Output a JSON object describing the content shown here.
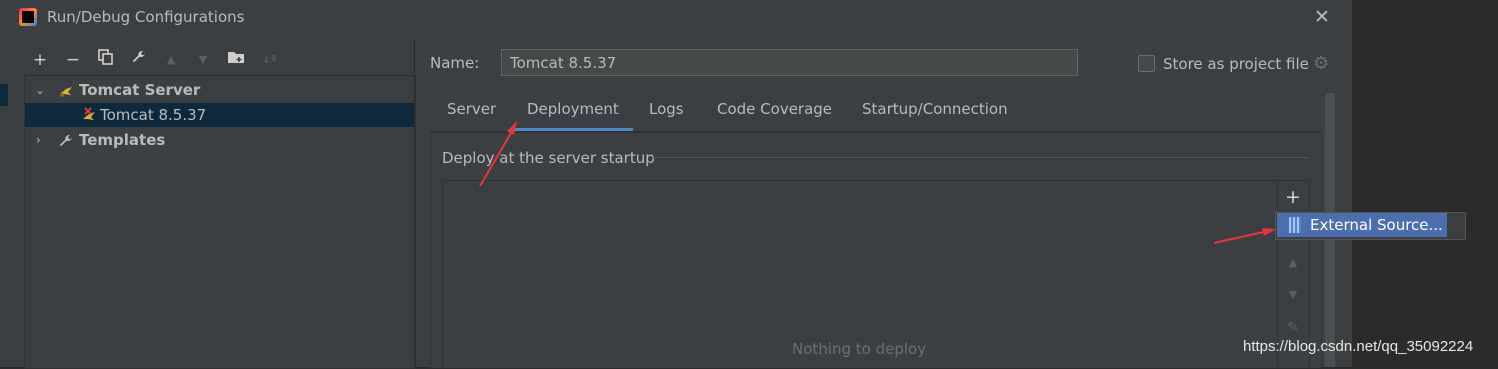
{
  "window": {
    "title": "Run/Debug Configurations"
  },
  "toolbar": {
    "add": "+",
    "remove": "−",
    "copy": "⧉",
    "edit": "🔧",
    "move_up": "▲",
    "move_down": "▼",
    "folder": "📁",
    "sort": "↓ª"
  },
  "tree": {
    "items": [
      {
        "label": "Tomcat Server",
        "expanded": true,
        "icon": "tomcat-icon"
      },
      {
        "label": "Tomcat 8.5.37",
        "selected": true,
        "icon": "tomcat-config-icon"
      },
      {
        "label": "Templates",
        "expanded": false,
        "icon": "wrench-icon"
      }
    ]
  },
  "form": {
    "name_label": "Name:",
    "name_value": "Tomcat 8.5.37",
    "store_label": "Store as project file",
    "store_checked": false
  },
  "tabs": [
    "Server",
    "Deployment",
    "Logs",
    "Code Coverage",
    "Startup/Connection"
  ],
  "active_tab": "Deployment",
  "deploy": {
    "section_title": "Deploy at the server startup",
    "empty_text": "Nothing to deploy"
  },
  "popup": {
    "item": "External Source..."
  },
  "watermark": "https://blog.csdn.net/qq_35092224",
  "colors": {
    "background": "#3c3f41",
    "selection": "#0d293e",
    "popup_selection": "#4b6eaf",
    "tab_underline": "#4a88c7",
    "annotation_arrow": "#e8343a"
  }
}
